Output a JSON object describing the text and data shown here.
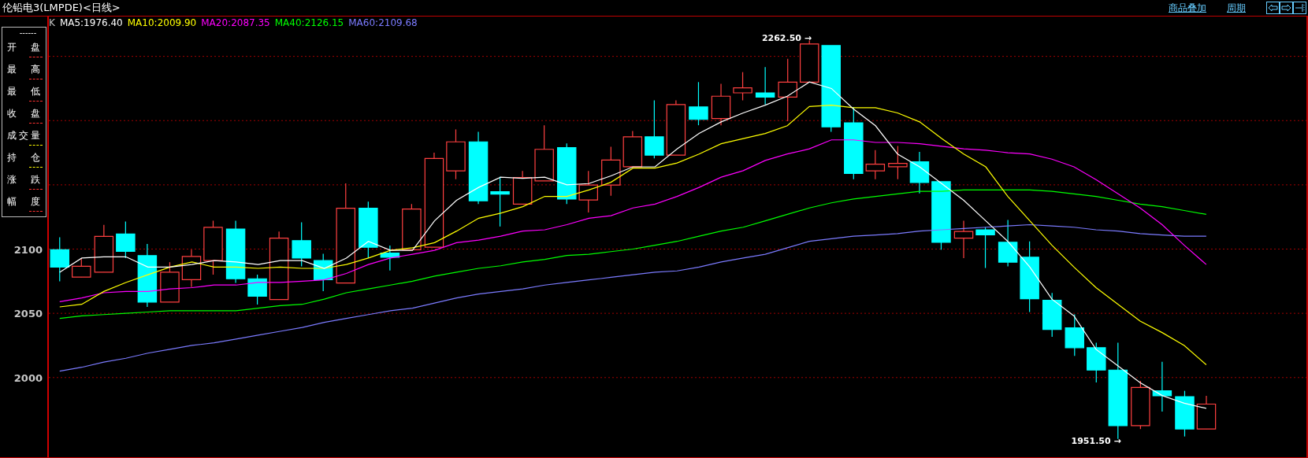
{
  "window": {
    "title": "伦铅电3(LMPDE)<日线>"
  },
  "toolbar": {
    "links": [
      "商品叠加",
      "周期"
    ]
  },
  "legend_label": "K",
  "info_panel": {
    "header": "------",
    "rows": [
      {
        "label": "开盘",
        "color": "#ff3030"
      },
      {
        "label": "最高",
        "color": "#ff3030"
      },
      {
        "label": "最低",
        "color": "#ff3030"
      },
      {
        "label": "收盘",
        "color": "#ff3030"
      },
      {
        "label": "成交量",
        "color": "#ffff00"
      },
      {
        "label": "持仓",
        "color": "#ffff00"
      },
      {
        "label": "涨跌",
        "color": "#ff3030"
      },
      {
        "label": "幅度",
        "color": "#ff3030"
      }
    ]
  },
  "chart_data": {
    "type": "line",
    "grid": true,
    "ylim": [
      1938,
      2281
    ],
    "yticks": [
      2000,
      2050,
      2100
    ],
    "series": [
      {
        "name": "MA5:1976.40",
        "color": "#ffffff",
        "values": [
          2082,
          2093,
          2094,
          2094,
          2086,
          2086,
          2088,
          2091,
          2090,
          2088,
          2091,
          2091,
          2085,
          2093,
          2106,
          2099,
          2099,
          2122,
          2138,
          2148,
          2156,
          2155,
          2156,
          2150,
          2151,
          2157,
          2164,
          2164,
          2178,
          2190,
          2199,
          2206,
          2212,
          2219,
          2230,
          2225,
          2209,
          2196,
          2174,
          2164,
          2151,
          2138,
          2122,
          2106,
          2086,
          2061,
          2048,
          2022,
          2009,
          1996,
          1986,
          1980,
          1976
        ]
      },
      {
        "name": "MA10:2009.90",
        "color": "#ffff00",
        "values": [
          2055,
          2057,
          2067,
          2074,
          2080,
          2086,
          2090,
          2086,
          2086,
          2085,
          2086,
          2085,
          2085,
          2088,
          2093,
          2099,
          2101,
          2105,
          2114,
          2124,
          2128,
          2133,
          2141,
          2141,
          2146,
          2152,
          2163,
          2163,
          2167,
          2174,
          2182,
          2186,
          2190,
          2196,
          2211,
          2212,
          2210,
          2210,
          2206,
          2199,
          2186,
          2174,
          2164,
          2141,
          2122,
          2103,
          2086,
          2070,
          2057,
          2044,
          2035,
          2025,
          2010
        ]
      },
      {
        "name": "MA20:2087.35",
        "color": "#ff00ff",
        "values": [
          2059,
          2062,
          2066,
          2067,
          2067,
          2069,
          2070,
          2072,
          2072,
          2074,
          2074,
          2075,
          2076,
          2081,
          2088,
          2093,
          2096,
          2099,
          2105,
          2107,
          2110,
          2114,
          2115,
          2119,
          2124,
          2126,
          2132,
          2135,
          2141,
          2148,
          2156,
          2161,
          2169,
          2174,
          2178,
          2185,
          2185,
          2183,
          2183,
          2182,
          2180,
          2178,
          2177,
          2175,
          2174,
          2170,
          2164,
          2154,
          2143,
          2132,
          2119,
          2103,
          2088
        ]
      },
      {
        "name": "MA40:2126.15",
        "color": "#00ff00",
        "values": [
          2046,
          2048,
          2049,
          2050,
          2051,
          2052,
          2052,
          2052,
          2052,
          2054,
          2056,
          2057,
          2061,
          2066,
          2069,
          2072,
          2075,
          2079,
          2082,
          2085,
          2087,
          2090,
          2092,
          2095,
          2096,
          2098,
          2100,
          2103,
          2106,
          2110,
          2114,
          2117,
          2122,
          2127,
          2132,
          2136,
          2139,
          2141,
          2143,
          2145,
          2145,
          2146,
          2146,
          2146,
          2146,
          2145,
          2143,
          2141,
          2138,
          2135,
          2133,
          2130,
          2127
        ]
      },
      {
        "name": "MA60:2109.68",
        "color": "#7b7bff",
        "values": [
          2005,
          2008,
          2012,
          2015,
          2019,
          2022,
          2025,
          2027,
          2030,
          2033,
          2036,
          2039,
          2043,
          2046,
          2049,
          2052,
          2054,
          2058,
          2062,
          2065,
          2067,
          2069,
          2072,
          2074,
          2076,
          2078,
          2080,
          2082,
          2083,
          2086,
          2090,
          2093,
          2096,
          2101,
          2106,
          2108,
          2110,
          2111,
          2112,
          2114,
          2115,
          2116,
          2117,
          2118,
          2119,
          2118,
          2117,
          2115,
          2114,
          2112,
          2111,
          2110,
          2110
        ]
      }
    ]
  },
  "annotations": [
    {
      "label": "2262.50 →"
    },
    {
      "label": "1951.50 →"
    }
  ]
}
